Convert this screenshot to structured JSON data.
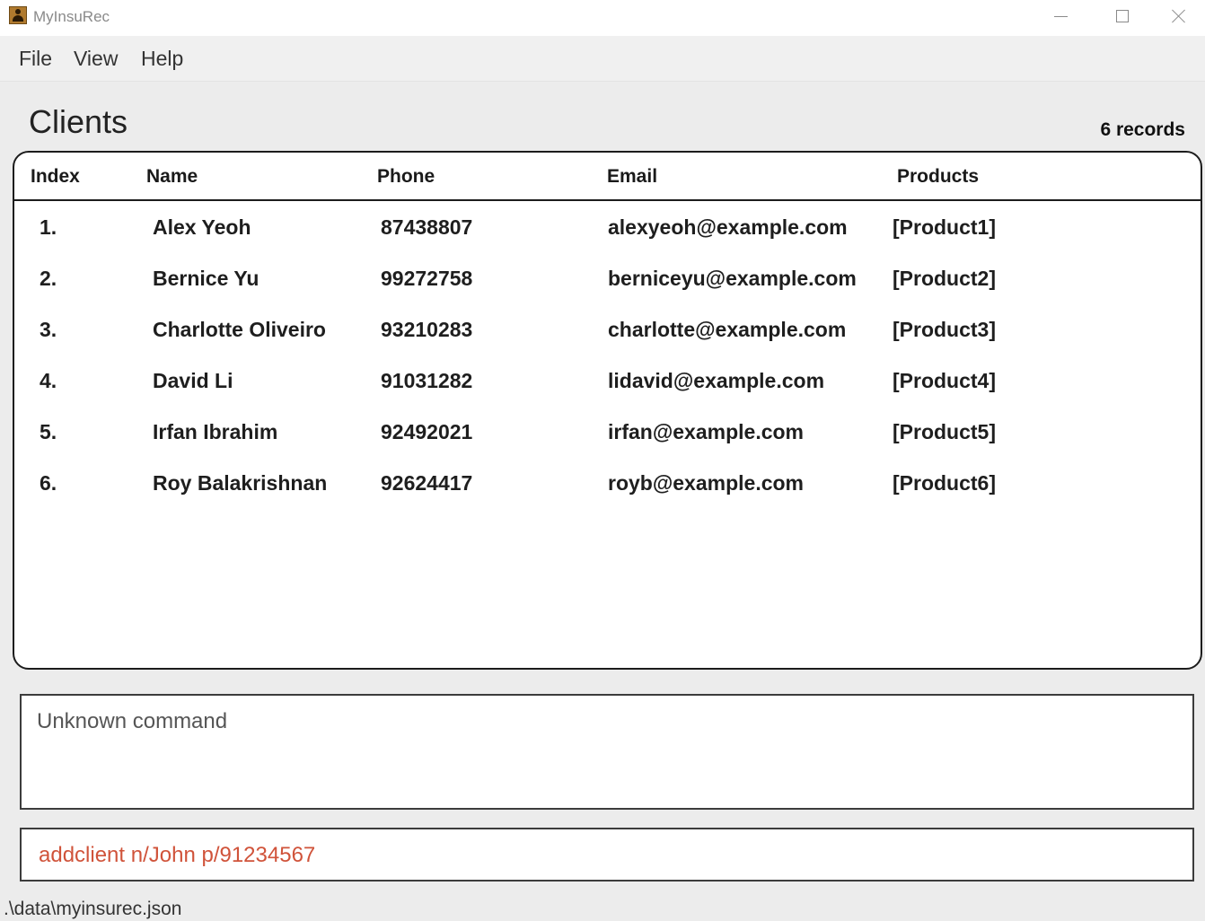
{
  "window": {
    "title": "MyInsuRec",
    "app_icon": "contacts-book-icon"
  },
  "menu": [
    "File",
    "View",
    "Help"
  ],
  "clients_panel": {
    "title": "Clients",
    "record_count": "6 records"
  },
  "table": {
    "headers": [
      "Index",
      "Name",
      "Phone",
      "Email",
      "Products"
    ],
    "rows": [
      [
        "1.",
        "Alex Yeoh",
        "87438807",
        "alexyeoh@example.com",
        "[Product1]"
      ],
      [
        "2.",
        "Bernice Yu",
        "99272758",
        "berniceyu@example.com",
        "[Product2]"
      ],
      [
        "3.",
        "Charlotte Oliveiro",
        "93210283",
        "charlotte@example.com",
        "[Product3]"
      ],
      [
        "4.",
        "David Li",
        "91031282",
        "lidavid@example.com",
        "[Product4]"
      ],
      [
        "5.",
        "Irfan Ibrahim",
        "92492021",
        "irfan@example.com",
        "[Product5]"
      ],
      [
        "6.",
        "Roy Balakrishnan",
        "92624417",
        "royb@example.com",
        "[Product6]"
      ]
    ]
  },
  "result_display": {
    "text": "Unknown command"
  },
  "command_box": {
    "value": "addclient n/John p/91234567",
    "text_color": "#d0533a"
  },
  "status_bar": {
    "path": ".\\data\\myinsurec.json"
  }
}
